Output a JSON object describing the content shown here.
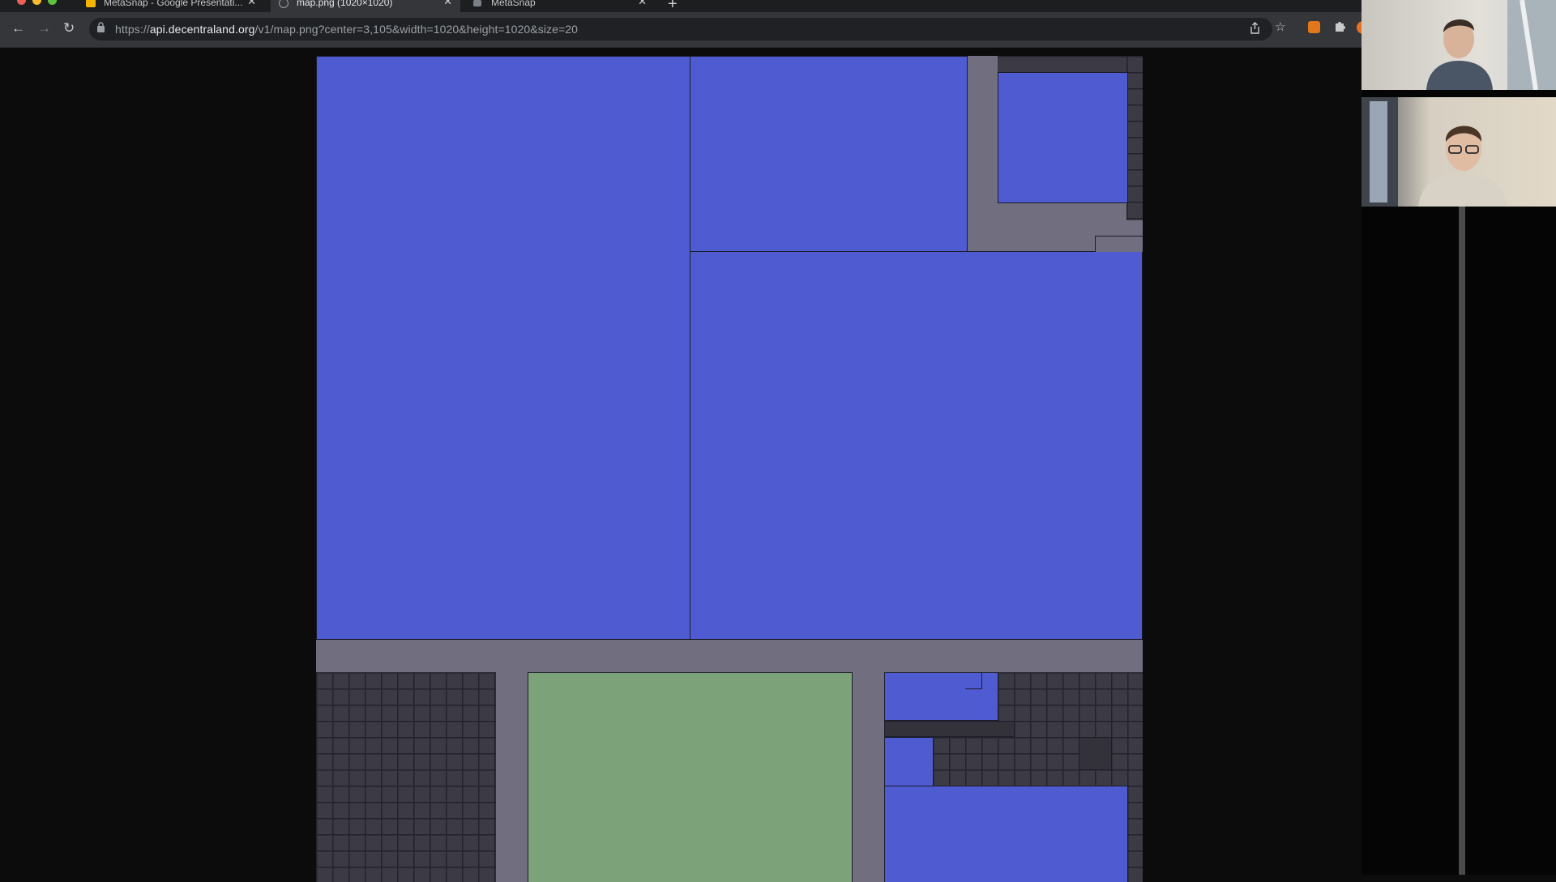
{
  "browser": {
    "tabs": [
      {
        "title": "MetaSnap - Google Presentati...",
        "favicon": "slides-icon",
        "favicon_color": "#f4b400",
        "active": false
      },
      {
        "title": "map.png (1020×1020)",
        "favicon": "globe-icon",
        "favicon_color": "#9aa0a6",
        "active": true
      },
      {
        "title": "MetaSnap",
        "favicon": "metasnap-icon",
        "favicon_color": "#9aa0a6",
        "active": false
      }
    ],
    "new_tab_glyph": "+",
    "close_glyph": "✕",
    "url": {
      "scheme": "https://",
      "host": "api.decentraland.org",
      "path": "/v1/map.png?center=3,105&width=1020&height=1020&size=20"
    },
    "nav": {
      "back": "←",
      "forward": "→",
      "reload": "↻"
    },
    "toolbar_icons": [
      "share-icon",
      "bookmark-star-icon",
      "metamask-fox-icon",
      "extensions-puzzle-icon",
      "profile-avatar-icon"
    ]
  },
  "map": {
    "colors": {
      "owned_parcel": "#4f5bd1",
      "road": "#716f7f",
      "plaza": "#7ca27a",
      "unowned_grid": "#3b3a45",
      "border": "#1c1d2a"
    }
  },
  "video_call": {
    "participants": [
      {
        "name": "",
        "shirt_color": "#4a5566",
        "wall_color": "#d9d6cf"
      },
      {
        "name": "",
        "shirt_color": "#d8d2c6",
        "wall_color": "#c9c1b3"
      }
    ]
  }
}
